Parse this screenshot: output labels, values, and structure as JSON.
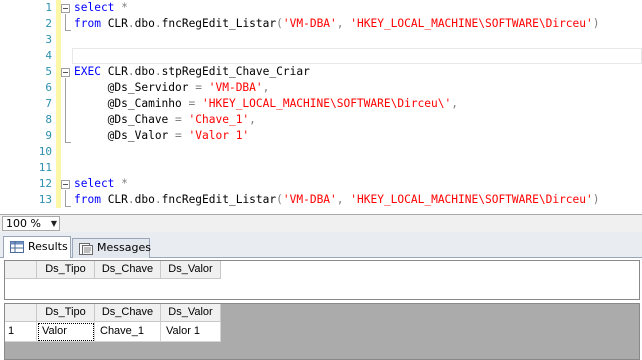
{
  "editor": {
    "lines": [
      {
        "n": "1",
        "tokens": [
          {
            "t": "select",
            "c": "kw"
          },
          {
            "t": " *",
            "c": "gr"
          }
        ]
      },
      {
        "n": "2",
        "tokens": [
          {
            "t": "from",
            "c": "kw"
          },
          {
            "t": " CLR",
            "c": "tx"
          },
          {
            "t": ".",
            "c": "gr"
          },
          {
            "t": "dbo",
            "c": "tx"
          },
          {
            "t": ".",
            "c": "gr"
          },
          {
            "t": "fncRegEdit_Listar",
            "c": "tx"
          },
          {
            "t": "(",
            "c": "gr"
          },
          {
            "t": "'VM-DBA'",
            "c": "st"
          },
          {
            "t": ", ",
            "c": "gr"
          },
          {
            "t": "'HKEY_LOCAL_MACHINE\\SOFTWARE\\Dirceu'",
            "c": "st"
          },
          {
            "t": ")",
            "c": "gr"
          }
        ]
      },
      {
        "n": "3",
        "tokens": []
      },
      {
        "n": "4",
        "tokens": []
      },
      {
        "n": "5",
        "tokens": [
          {
            "t": "EXEC",
            "c": "kw"
          },
          {
            "t": " CLR",
            "c": "tx"
          },
          {
            "t": ".",
            "c": "gr"
          },
          {
            "t": "dbo",
            "c": "tx"
          },
          {
            "t": ".",
            "c": "gr"
          },
          {
            "t": "stpRegEdit_Chave_Criar",
            "c": "tx"
          }
        ]
      },
      {
        "n": "6",
        "tokens": [
          {
            "t": "     @Ds_Servidor ",
            "c": "tx"
          },
          {
            "t": "=",
            "c": "gr"
          },
          {
            "t": " ",
            "c": "tx"
          },
          {
            "t": "'VM-DBA'",
            "c": "st"
          },
          {
            "t": ",",
            "c": "gr"
          }
        ]
      },
      {
        "n": "7",
        "tokens": [
          {
            "t": "     @Ds_Caminho ",
            "c": "tx"
          },
          {
            "t": "=",
            "c": "gr"
          },
          {
            "t": " ",
            "c": "tx"
          },
          {
            "t": "'HKEY_LOCAL_MACHINE\\SOFTWARE\\Dirceu\\'",
            "c": "st"
          },
          {
            "t": ",",
            "c": "gr"
          }
        ]
      },
      {
        "n": "8",
        "tokens": [
          {
            "t": "     @Ds_Chave ",
            "c": "tx"
          },
          {
            "t": "=",
            "c": "gr"
          },
          {
            "t": " ",
            "c": "tx"
          },
          {
            "t": "'Chave_1'",
            "c": "st"
          },
          {
            "t": ",",
            "c": "gr"
          }
        ]
      },
      {
        "n": "9",
        "tokens": [
          {
            "t": "     @Ds_Valor ",
            "c": "tx"
          },
          {
            "t": "=",
            "c": "gr"
          },
          {
            "t": " ",
            "c": "tx"
          },
          {
            "t": "'Valor 1'",
            "c": "st"
          }
        ]
      },
      {
        "n": "10",
        "tokens": []
      },
      {
        "n": "11",
        "tokens": []
      },
      {
        "n": "12",
        "tokens": [
          {
            "t": "select",
            "c": "kw"
          },
          {
            "t": " *",
            "c": "gr"
          }
        ]
      },
      {
        "n": "13",
        "tokens": [
          {
            "t": "from",
            "c": "kw"
          },
          {
            "t": " CLR",
            "c": "tx"
          },
          {
            "t": ".",
            "c": "gr"
          },
          {
            "t": "dbo",
            "c": "tx"
          },
          {
            "t": ".",
            "c": "gr"
          },
          {
            "t": "fncRegEdit_Listar",
            "c": "tx"
          },
          {
            "t": "(",
            "c": "gr"
          },
          {
            "t": "'VM-DBA'",
            "c": "st"
          },
          {
            "t": ", ",
            "c": "gr"
          },
          {
            "t": "'HKEY_LOCAL_MACHINE\\SOFTWARE\\Dirceu'",
            "c": "st"
          },
          {
            "t": ")",
            "c": "gr"
          }
        ]
      }
    ]
  },
  "zoom": {
    "value": "100 %",
    "arrow": "▼"
  },
  "tabs": {
    "results": "Results",
    "messages": "Messages"
  },
  "grid1": {
    "columns": [
      "Ds_Tipo",
      "Ds_Chave",
      "Ds_Valor"
    ],
    "rows": []
  },
  "grid2": {
    "columns": [
      "Ds_Tipo",
      "Ds_Chave",
      "Ds_Valor"
    ],
    "rows": [
      {
        "num": "1",
        "cells": [
          "Valor",
          "Chave_1",
          "Valor 1"
        ]
      }
    ]
  },
  "colors": {
    "keyword": "#0000ff",
    "string": "#ff0000",
    "operator": "#808080",
    "line_number": "#2b91af",
    "change_marker": "#fcf6a7"
  }
}
